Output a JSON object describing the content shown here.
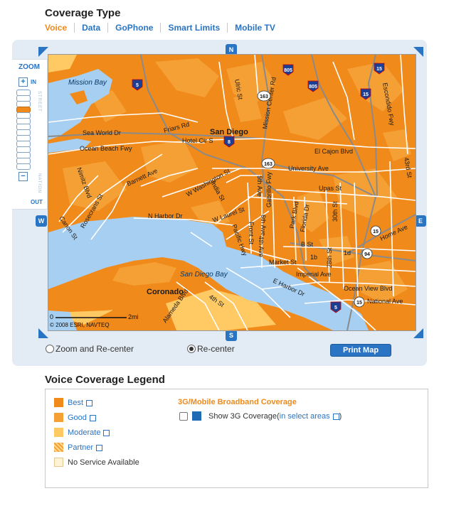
{
  "header": {
    "title": "Coverage Type"
  },
  "tabs": [
    "Voice",
    "Data",
    "GoPhone",
    "Smart Limits",
    "Mobile TV"
  ],
  "zoom": {
    "title": "ZOOM",
    "in_label": "IN",
    "out_label": "OUT",
    "street_label": "STREET",
    "nation_label": "NATION",
    "plus": "+",
    "minus": "−",
    "level_count": 14,
    "active_index": 3
  },
  "compass": {
    "north": "N",
    "south": "S",
    "east": "E",
    "west": "W"
  },
  "map": {
    "labels": {
      "mission_bay": "Mission Bay",
      "san_diego_bay": "San Diego Bay",
      "coronado": "Coronado",
      "san_diego": "San Diego",
      "sea_world": "Sea World Dr",
      "ocean_beach": "Ocean Beach Fwy",
      "friars": "Friars Rd",
      "hotel_cir": "Hotel Cir S",
      "el_cajon": "El Cajon Blvd",
      "university": "University Ave",
      "upas": "Upas St",
      "barnett": "Barnett Ave",
      "washington": "W Washington St",
      "nimitz": "Nimitz Blvd",
      "rosecrans": "Rosecrans St",
      "canon": "Canon St",
      "n_harbor": "N Harbor Dr",
      "w_laurel": "W Laurel St",
      "india": "India St",
      "pacific": "Pacific Hwy",
      "front": "Front St",
      "fifth": "5th Ave",
      "fourth": "4th Ave",
      "sixth": "6th Ave",
      "gabrillo": "Gabrillo Fwy",
      "park": "Park Blvd",
      "florida": "Florida Dr",
      "thirtieth": "30th St",
      "twentyeighth": "28th St",
      "b_st": "B St",
      "market": "Market St",
      "imperial": "Imperial Ave",
      "ocean_view": "Ocean View Blvd",
      "national": "National Ave",
      "e_harbor": "E Harbor Dr",
      "home": "Home Ave",
      "one_d": "1d",
      "one_b": "1b",
      "alameda": "Alameda Blvd",
      "fourth_st": "4th St",
      "escondido": "Escondido Fwy",
      "fortythird": "43rd St",
      "ulric": "Ulric St",
      "mission_center": "Mission Center Rd",
      "scale_zero": "0",
      "scale_two": "2mi",
      "copyright": "© 2008 ESRI, NAVTEQ"
    },
    "shields": {
      "i5a": "5",
      "i5b": "5",
      "i5c": "5",
      "i8": "8",
      "i805a": "805",
      "i805b": "805",
      "i15a": "15",
      "i15b": "15",
      "r163a": "163",
      "r163b": "163",
      "r15": "15",
      "r94": "94",
      "r15b": "15"
    }
  },
  "controls": {
    "zoom_recenter": "Zoom and Re-center",
    "recenter": "Re-center",
    "print": "Print Map"
  },
  "legend": {
    "title": "Voice Coverage Legend",
    "items": [
      {
        "label": "Best",
        "color": "#f08a1a"
      },
      {
        "label": "Good",
        "color": "#f5a035"
      },
      {
        "label": "Moderate",
        "color": "#ffc964"
      },
      {
        "label": "Partner",
        "color": "#f5a035"
      },
      {
        "label": "No Service Available",
        "color": "#fff3d6"
      }
    ],
    "broadband_title": "3G/Mobile Broadband Coverage",
    "show3g": "Show 3G Coverage(",
    "select_areas": "in select areas",
    "close_paren": ")"
  },
  "colors": {
    "accent": "#f08a1a",
    "link": "#2a74c4",
    "water": "#a6cff2",
    "land_best": "#f08a1a",
    "land_good": "#f5a035"
  }
}
